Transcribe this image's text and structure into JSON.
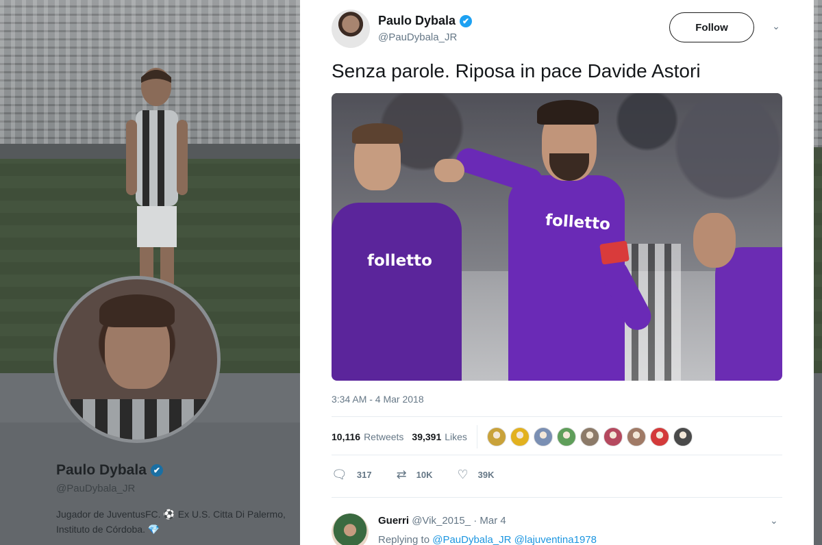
{
  "background_profile": {
    "name": "Paulo Dybala",
    "handle": "@PauDybala_JR",
    "bio": "Jugador de JuventusFC. ⚽ Ex U.S. Citta Di Palermo, Instituto de Córdoba. 💎"
  },
  "tweet": {
    "author_name": "Paulo Dybala",
    "author_handle": "@PauDybala_JR",
    "verified_icon": "✔",
    "follow_label": "Follow",
    "menu_icon": "⌄",
    "text": "Senza parole. Riposa in pace Davide Astori",
    "media": {
      "sponsor_left": "folletto",
      "sponsor_center": "folletto"
    },
    "timestamp": "3:34 AM - 4 Mar 2018",
    "stats": {
      "retweets_count": "10,116",
      "retweets_label": "Retweets",
      "likes_count": "39,391",
      "likes_label": "Likes"
    },
    "likers": [
      {
        "color": "#c9a23a"
      },
      {
        "color": "#e2b11f"
      },
      {
        "color": "#7a8fb3"
      },
      {
        "color": "#5f9e5a"
      },
      {
        "color": "#8c7a68"
      },
      {
        "color": "#b5495f"
      },
      {
        "color": "#a07a66"
      },
      {
        "color": "#d33a3a"
      },
      {
        "color": "#4a4a4a"
      }
    ],
    "actions": {
      "reply_icon": "🗨",
      "reply_count": "317",
      "retweet_icon": "⇄",
      "retweet_count": "10K",
      "like_icon": "♡",
      "like_count": "39K"
    }
  },
  "reply": {
    "name": "Guerri",
    "handle": "@Vik_2015_",
    "date": "· Mar 4",
    "replying_prefix": "Replying to",
    "mentions": "@PauDybala_JR @lajuventina1978",
    "menu_icon": "⌄"
  },
  "colors": {
    "accent": "#1da1f2",
    "link": "#1b95e0",
    "muted": "#657786",
    "jersey": "#6a2ab6"
  }
}
